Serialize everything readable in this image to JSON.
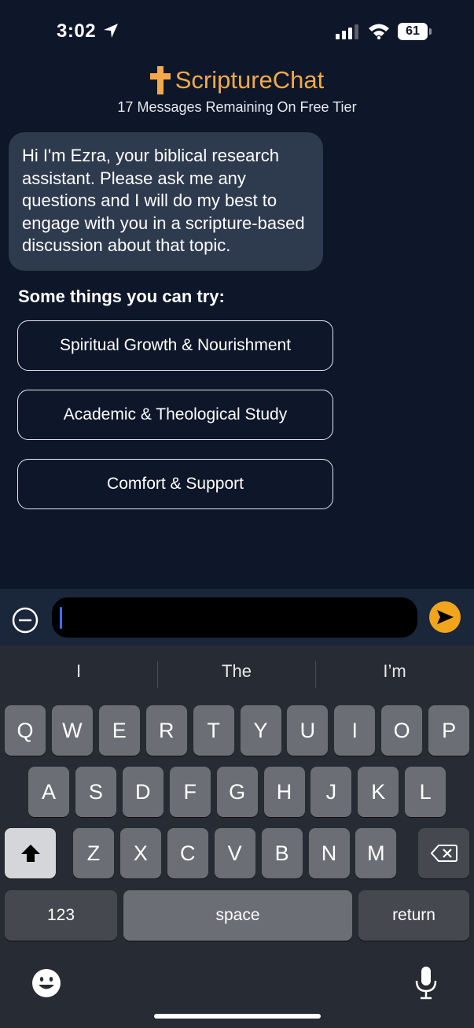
{
  "status_bar": {
    "time": "3:02",
    "battery": "61"
  },
  "header": {
    "title": "ScriptureChat",
    "subtitle": "17 Messages Remaining On Free Tier"
  },
  "bot_message": "Hi I'm Ezra, your biblical research assistant. Please ask me any questions and I will do my best to engage with you in a scripture-based discussion about that topic.",
  "suggestions": {
    "heading": "Some things you can try:",
    "items": [
      "Spiritual Growth & Nourishment",
      "Academic & Theological Study",
      "Comfort & Support"
    ]
  },
  "input": {
    "value": ""
  },
  "keyboard": {
    "predictions": [
      "I",
      "The",
      "I’m"
    ],
    "row1": [
      "Q",
      "W",
      "E",
      "R",
      "T",
      "Y",
      "U",
      "I",
      "O",
      "P"
    ],
    "row2": [
      "A",
      "S",
      "D",
      "F",
      "G",
      "H",
      "J",
      "K",
      "L"
    ],
    "row3": [
      "Z",
      "X",
      "C",
      "V",
      "B",
      "N",
      "M"
    ],
    "numbers_label": "123",
    "space_label": "space",
    "return_label": "return"
  },
  "colors": {
    "accent": "#f3a94a",
    "background": "#0d1729",
    "bubble": "#2e3a4e",
    "send": "#f0a51d"
  }
}
